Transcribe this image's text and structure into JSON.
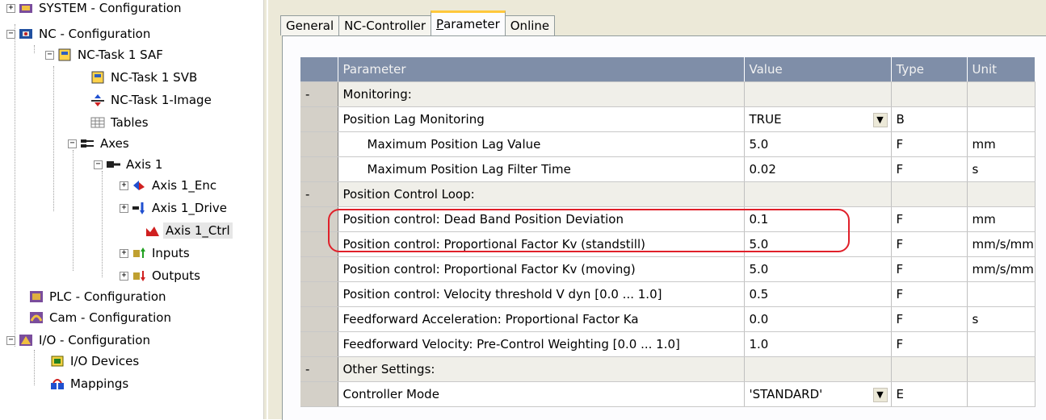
{
  "tree": {
    "items": [
      {
        "label": "SYSTEM - Configuration",
        "icon": "system-config-icon",
        "exp": "+"
      },
      {
        "label": "NC - Configuration",
        "icon": "nc-config-icon",
        "exp": "-"
      },
      {
        "label": "NC-Task 1 SAF",
        "icon": "task-icon",
        "exp": "-"
      },
      {
        "label": "NC-Task 1 SVB",
        "icon": "task-icon",
        "exp": ""
      },
      {
        "label": "NC-Task 1-Image",
        "icon": "image-icon",
        "exp": ""
      },
      {
        "label": "Tables",
        "icon": "table-icon",
        "exp": ""
      },
      {
        "label": "Axes",
        "icon": "axes-icon",
        "exp": "-"
      },
      {
        "label": "Axis 1",
        "icon": "axis-icon",
        "exp": "-"
      },
      {
        "label": "Axis 1_Enc",
        "icon": "encoder-icon",
        "exp": "+"
      },
      {
        "label": "Axis 1_Drive",
        "icon": "drive-icon",
        "exp": "+"
      },
      {
        "label": "Axis 1_Ctrl",
        "icon": "controller-icon",
        "exp": ""
      },
      {
        "label": "Inputs",
        "icon": "inputs-icon",
        "exp": "+"
      },
      {
        "label": "Outputs",
        "icon": "outputs-icon",
        "exp": "+"
      },
      {
        "label": "PLC - Configuration",
        "icon": "plc-config-icon",
        "exp": ""
      },
      {
        "label": "Cam - Configuration",
        "icon": "cam-config-icon",
        "exp": ""
      },
      {
        "label": "I/O - Configuration",
        "icon": "io-config-icon",
        "exp": "-"
      },
      {
        "label": "I/O Devices",
        "icon": "io-devices-icon",
        "exp": ""
      },
      {
        "label": "Mappings",
        "icon": "mappings-icon",
        "exp": ""
      }
    ]
  },
  "tabs": [
    "General",
    "NC-Controller",
    "Parameter",
    "Online"
  ],
  "active_tab": "Parameter",
  "grid": {
    "headers": {
      "parameter": "Parameter",
      "value": "Value",
      "type": "Type",
      "unit": "Unit"
    },
    "rows": [
      {
        "lead": "-",
        "parameter": "Monitoring:",
        "value": "",
        "type": "",
        "unit": "",
        "group": true
      },
      {
        "lead": "",
        "parameter": "Position Lag Monitoring",
        "value": "TRUE",
        "type": "B",
        "unit": "",
        "dropdown": true
      },
      {
        "lead": "",
        "parameter": "Maximum Position Lag Value",
        "value": "5.0",
        "type": "F",
        "unit": "mm",
        "indent": true
      },
      {
        "lead": "",
        "parameter": "Maximum Position Lag Filter Time",
        "value": "0.02",
        "type": "F",
        "unit": "s",
        "indent": true
      },
      {
        "lead": "-",
        "parameter": "Position Control Loop:",
        "value": "",
        "type": "",
        "unit": "",
        "group": true
      },
      {
        "lead": "",
        "parameter": "Position control: Dead Band Position Deviation",
        "value": "0.1",
        "type": "F",
        "unit": "mm"
      },
      {
        "lead": "",
        "parameter": "Position control: Proportional Factor Kv (standstill)",
        "value": "5.0",
        "type": "F",
        "unit": "mm/s/mm"
      },
      {
        "lead": "",
        "parameter": "Position control: Proportional Factor Kv (moving)",
        "value": "5.0",
        "type": "F",
        "unit": "mm/s/mm"
      },
      {
        "lead": "",
        "parameter": "Position control: Velocity threshold V dyn [0.0 ... 1.0]",
        "value": "0.5",
        "type": "F",
        "unit": ""
      },
      {
        "lead": "",
        "parameter": "Feedforward Acceleration: Proportional Factor Ka",
        "value": "0.0",
        "type": "F",
        "unit": "s"
      },
      {
        "lead": "",
        "parameter": "Feedforward Velocity: Pre-Control Weighting [0.0 ... 1.0]",
        "value": "1.0",
        "type": "F",
        "unit": ""
      },
      {
        "lead": "-",
        "parameter": "Other Settings:",
        "value": "",
        "type": "",
        "unit": "",
        "group": true
      },
      {
        "lead": "",
        "parameter": "Controller Mode",
        "value": "'STANDARD'",
        "type": "E",
        "unit": "",
        "dropdown": true
      }
    ]
  },
  "colors": {
    "header_bg": "#7f8ea8",
    "highlight": "#e0202a",
    "tab_accent": "#ffc83c"
  }
}
